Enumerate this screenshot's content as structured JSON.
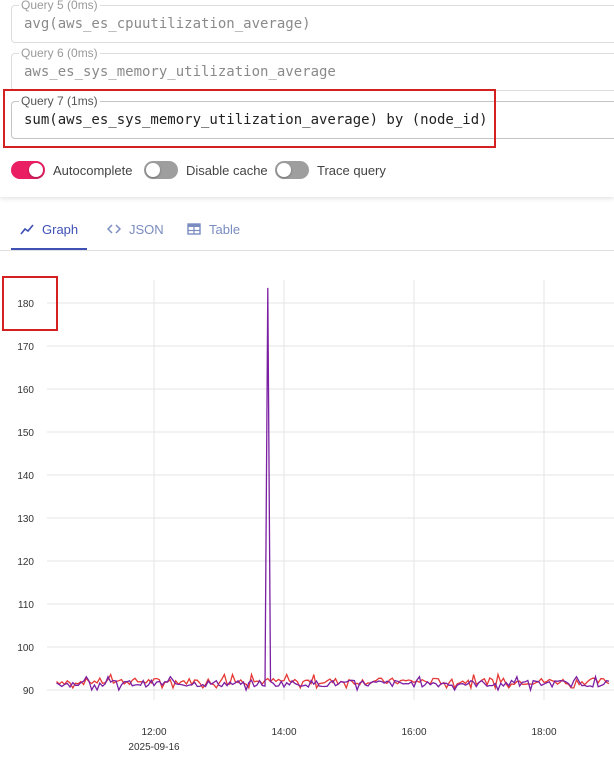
{
  "queries": [
    {
      "label": "Query 5 (0ms)",
      "expr": "avg(aws_es_cpuutilization_average)"
    },
    {
      "label": "Query 6 (0ms)",
      "expr": "aws_es_sys_memory_utilization_average"
    },
    {
      "label": "Query 7 (1ms)",
      "expr": "sum(aws_es_sys_memory_utilization_average) by (node_id)"
    }
  ],
  "options": [
    {
      "label": "Autocomplete",
      "on": true
    },
    {
      "label": "Disable cache",
      "on": false
    },
    {
      "label": "Trace query",
      "on": false
    }
  ],
  "tabs": [
    {
      "label": "Graph",
      "icon": "line-chart-icon",
      "active": true
    },
    {
      "label": "JSON",
      "icon": "code-icon",
      "active": false
    },
    {
      "label": "Table",
      "icon": "table-icon",
      "active": false
    }
  ],
  "colors": {
    "accent": "#e91e63",
    "tab_active": "#3f51b5",
    "highlight": "#d32020"
  },
  "chart_data": {
    "type": "line",
    "y_ticks": [
      "90",
      "100",
      "110",
      "120",
      "130",
      "140",
      "150",
      "160",
      "170",
      "180"
    ],
    "ylim": [
      88,
      186
    ],
    "x_ticks": [
      "12:00",
      "14:00",
      "16:00",
      "18:00"
    ],
    "x_date_label": "2025-09-16",
    "x_range": [
      "10:30",
      "19:00"
    ],
    "grid": true,
    "series": [
      {
        "color": "#e53935",
        "baseline": 92,
        "spike": null
      },
      {
        "color": "#7b1fa2",
        "baseline": 91.5,
        "spike": {
          "time": "13:45",
          "value": 183.5
        }
      }
    ]
  }
}
